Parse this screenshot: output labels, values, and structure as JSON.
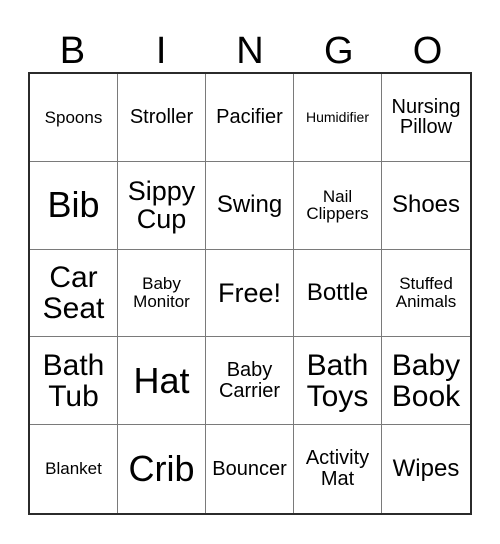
{
  "card": {
    "title": "BINGO",
    "header_letters": [
      "B",
      "I",
      "N",
      "G",
      "O"
    ],
    "free_space_label": "Free!",
    "colors": {
      "text": "#000000",
      "background": "#ffffff",
      "outer_border": "#2b2b2b",
      "inner_grid_line": "#7a7a7a"
    },
    "rows": [
      [
        {
          "label": "Spoons",
          "size": "s"
        },
        {
          "label": "Stroller",
          "size": "m"
        },
        {
          "label": "Pacifier",
          "size": "m"
        },
        {
          "label": "Humidifier",
          "size": "xs"
        },
        {
          "label": "Nursing\nPillow",
          "size": "m"
        }
      ],
      [
        {
          "label": "Bib",
          "size": "huge"
        },
        {
          "label": "Sippy\nCup",
          "size": "xl"
        },
        {
          "label": "Swing",
          "size": "l"
        },
        {
          "label": "Nail\nClippers",
          "size": "s"
        },
        {
          "label": "Shoes",
          "size": "l"
        }
      ],
      [
        {
          "label": "Car\nSeat",
          "size": "xxl"
        },
        {
          "label": "Baby\nMonitor",
          "size": "s"
        },
        {
          "label": "Free!",
          "size": "xl"
        },
        {
          "label": "Bottle",
          "size": "l"
        },
        {
          "label": "Stuffed\nAnimals",
          "size": "s"
        }
      ],
      [
        {
          "label": "Bath\nTub",
          "size": "xxl"
        },
        {
          "label": "Hat",
          "size": "huge"
        },
        {
          "label": "Baby\nCarrier",
          "size": "m"
        },
        {
          "label": "Bath\nToys",
          "size": "xxl"
        },
        {
          "label": "Baby\nBook",
          "size": "xxl"
        }
      ],
      [
        {
          "label": "Blanket",
          "size": "s"
        },
        {
          "label": "Crib",
          "size": "huge"
        },
        {
          "label": "Bouncer",
          "size": "m"
        },
        {
          "label": "Activity\nMat",
          "size": "m"
        },
        {
          "label": "Wipes",
          "size": "l"
        }
      ]
    ]
  }
}
